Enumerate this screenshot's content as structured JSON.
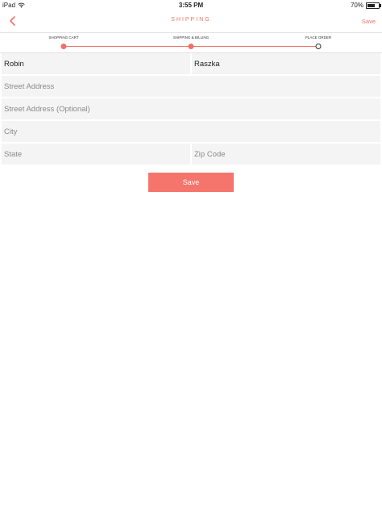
{
  "status_bar": {
    "device": "iPad",
    "time": "3:55 PM",
    "battery": "70%",
    "battery_level": 0.7
  },
  "nav": {
    "title": "SHIPPING",
    "save_label": "Save",
    "back_icon": "chevron-left-icon",
    "accent_color": "#f07168"
  },
  "progress": {
    "steps": [
      {
        "label": "SHOPPING CART",
        "state": "done"
      },
      {
        "label": "SHIPPING & BILLING",
        "state": "done"
      },
      {
        "label": "PLACE ORDER",
        "state": "current"
      }
    ]
  },
  "form": {
    "first_name": "Robin",
    "last_name": "Raszka",
    "street_placeholder": "Street Address",
    "street2_placeholder": "Street Address (Optional)",
    "city_placeholder": "City",
    "state_placeholder": "State",
    "zip_placeholder": "Zip Code",
    "save_label": "Save",
    "button_color": "#f5756c"
  }
}
